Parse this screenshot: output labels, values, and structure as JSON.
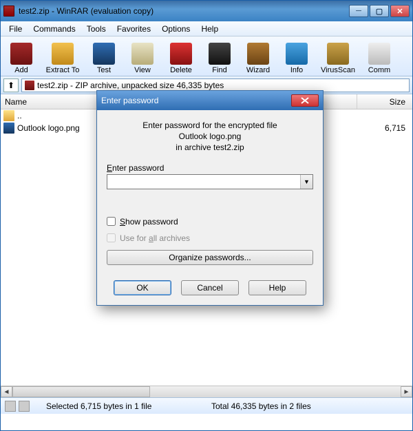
{
  "window": {
    "title": "test2.zip - WinRAR (evaluation copy)"
  },
  "menu": {
    "file": "File",
    "commands": "Commands",
    "tools": "Tools",
    "favorites": "Favorites",
    "options": "Options",
    "help": "Help"
  },
  "toolbar": {
    "add": "Add",
    "extract": "Extract To",
    "test": "Test",
    "view": "View",
    "delete": "Delete",
    "find": "Find",
    "wizard": "Wizard",
    "info": "Info",
    "virusscan": "VirusScan",
    "comment": "Comm"
  },
  "addressbar": {
    "path": "test2.zip - ZIP archive, unpacked size 46,335 bytes"
  },
  "columns": {
    "name": "Name",
    "size": "Size"
  },
  "rows": {
    "up": "..",
    "file1_name": "Outlook logo.png",
    "file1_size": "6,715"
  },
  "status": {
    "selected": "Selected 6,715 bytes in 1 file",
    "total": "Total 46,335 bytes in 2 files"
  },
  "dialog": {
    "title": "Enter password",
    "prompt_line1": "Enter password for the encrypted file",
    "prompt_file": "Outlook logo.png",
    "prompt_line3": "in archive test2.zip",
    "field_label": "Enter password",
    "show_password": "Show password",
    "use_all": "Use for all archives",
    "organize": "Organize passwords...",
    "ok": "OK",
    "cancel": "Cancel",
    "help": "Help"
  }
}
